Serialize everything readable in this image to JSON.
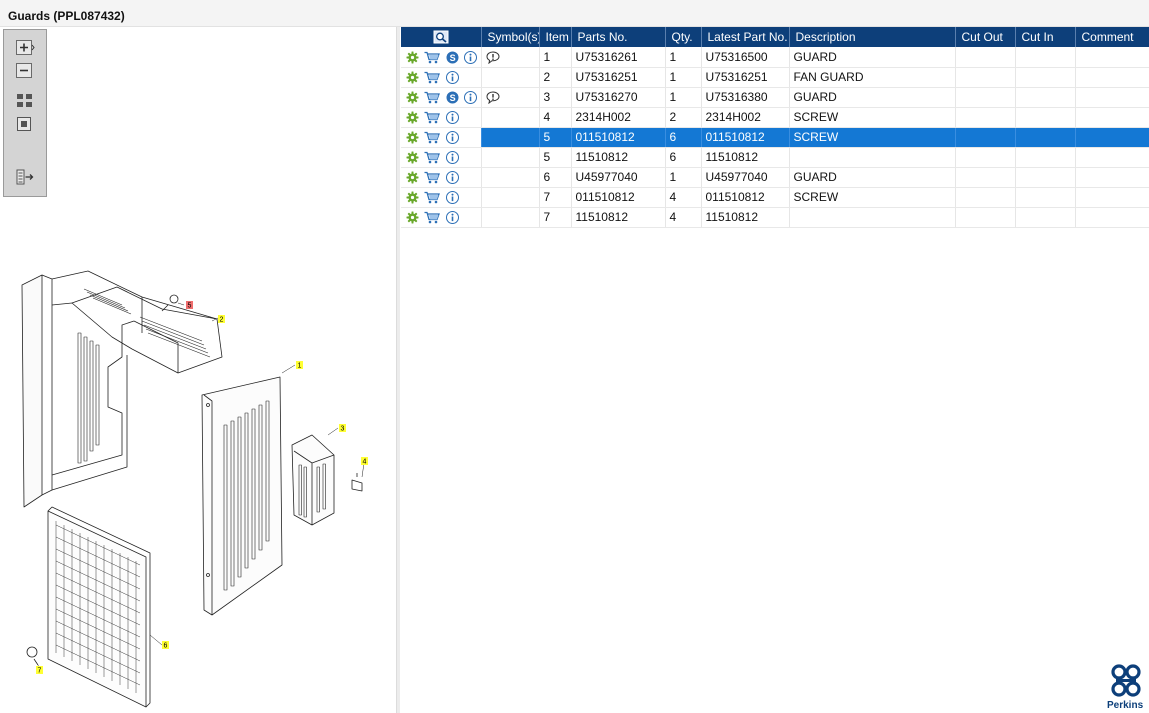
{
  "window": {
    "title": "Guards (PPL087432)"
  },
  "toolbar": {
    "buttons": [
      {
        "name": "zoom-in-button",
        "icon": "plus-icon"
      },
      {
        "name": "zoom-out-button",
        "icon": "minus-icon"
      },
      {
        "name": "fit-all-button",
        "icon": "fit-all-icon"
      },
      {
        "name": "actual-size-button",
        "icon": "square-icon"
      },
      {
        "name": "export-list-button",
        "icon": "list-arrow-icon"
      }
    ]
  },
  "drawing": {
    "callouts": [
      {
        "label": "1"
      },
      {
        "label": "2"
      },
      {
        "label": "3"
      },
      {
        "label": "4"
      },
      {
        "label": "5",
        "highlighted": true
      },
      {
        "label": "6"
      },
      {
        "label": "7"
      }
    ]
  },
  "grid": {
    "columns": [
      "",
      "Symbol(s)",
      "Item",
      "Parts No.",
      "Qty.",
      "Latest Part No.",
      "Description",
      "Cut Out",
      "Cut In",
      "Comment"
    ],
    "rows": [
      {
        "s_icon": true,
        "comment_icon": true,
        "item": "1",
        "part_no": "U75316261",
        "qty": "1",
        "latest": "U75316500",
        "desc": "GUARD",
        "cut_out": "",
        "cut_in": "",
        "comment": ""
      },
      {
        "s_icon": false,
        "comment_icon": false,
        "item": "2",
        "part_no": "U75316251",
        "qty": "1",
        "latest": "U75316251",
        "desc": "FAN GUARD",
        "cut_out": "",
        "cut_in": "",
        "comment": ""
      },
      {
        "s_icon": true,
        "comment_icon": true,
        "item": "3",
        "part_no": "U75316270",
        "qty": "1",
        "latest": "U75316380",
        "desc": "GUARD",
        "cut_out": "",
        "cut_in": "",
        "comment": ""
      },
      {
        "s_icon": false,
        "comment_icon": false,
        "item": "4",
        "part_no": "2314H002",
        "qty": "2",
        "latest": "2314H002",
        "desc": "SCREW",
        "cut_out": "",
        "cut_in": "",
        "comment": ""
      },
      {
        "s_icon": false,
        "comment_icon": false,
        "selected": true,
        "item": "5",
        "part_no": "011510812",
        "qty": "6",
        "latest": "011510812",
        "desc": "SCREW",
        "cut_out": "",
        "cut_in": "",
        "comment": ""
      },
      {
        "s_icon": false,
        "comment_icon": false,
        "item": "5",
        "part_no": "11510812",
        "qty": "6",
        "latest": "11510812",
        "desc": "",
        "cut_out": "",
        "cut_in": "",
        "comment": ""
      },
      {
        "s_icon": false,
        "comment_icon": false,
        "item": "6",
        "part_no": "U45977040",
        "qty": "1",
        "latest": "U45977040",
        "desc": "GUARD",
        "cut_out": "",
        "cut_in": "",
        "comment": ""
      },
      {
        "s_icon": false,
        "comment_icon": false,
        "item": "7",
        "part_no": "011510812",
        "qty": "4",
        "latest": "011510812",
        "desc": "SCREW",
        "cut_out": "",
        "cut_in": "",
        "comment": ""
      },
      {
        "s_icon": false,
        "comment_icon": false,
        "item": "7",
        "part_no": "11510812",
        "qty": "4",
        "latest": "11510812",
        "desc": "",
        "cut_out": "",
        "cut_in": "",
        "comment": ""
      }
    ]
  },
  "logo": {
    "text": "Perkins",
    "icon": "perkins-logo-icon"
  },
  "colors": {
    "header_bg": "#0d3f7a",
    "selected_row": "#1478d4",
    "gear_green": "#6aa82c",
    "cart_blue": "#2c6fb6",
    "callout_yellow": "#ffff33",
    "callout_red": "#f06e6e"
  }
}
